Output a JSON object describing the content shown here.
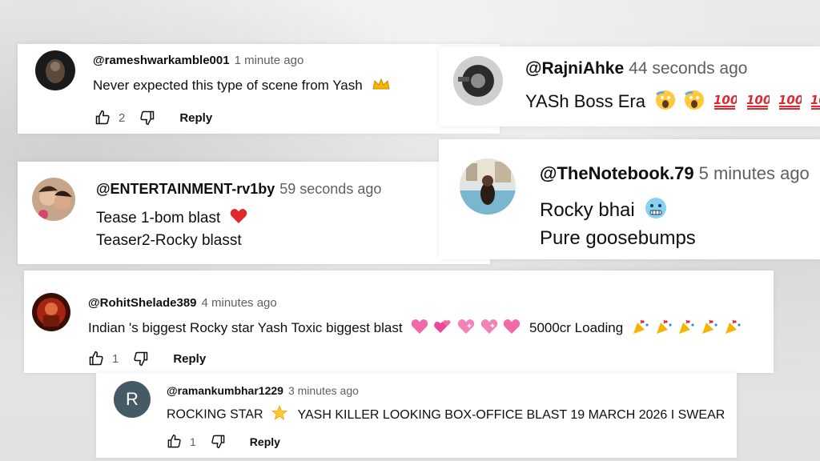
{
  "comments": [
    {
      "handle": "@rameshwarkamble001",
      "time": "1 minute ago",
      "lines": [
        "Never expected this type of scene from Yash"
      ],
      "emoji": "crown-emoji",
      "likes": "2",
      "reply_label": "Reply"
    },
    {
      "handle": "@RajniAhke",
      "time": "44 seconds ago",
      "lines": [
        "YASh Boss Era"
      ],
      "emoji": "screaming-face-and-hundred-points-emojis"
    },
    {
      "handle": "@ENTERTAINMENT-rv1by",
      "time": "59 seconds ago",
      "lines": [
        "Tease 1-bom blast",
        "Teaser2-Rocky blasst"
      ],
      "emoji": "red-heart-emoji"
    },
    {
      "handle": "@TheNotebook.79",
      "time": "5 minutes ago",
      "lines": [
        "Rocky bhai",
        "Pure goosebumps"
      ],
      "emoji": "cold-face-emoji"
    },
    {
      "handle": "@RohitShelade389",
      "time": "4 minutes ago",
      "text_before": "Indian 's biggest Rocky star Yash Toxic biggest blast",
      "text_after": "5000cr Loading",
      "emoji": "hearts-and-party-popper-emojis",
      "likes": "1",
      "reply_label": "Reply"
    },
    {
      "handle": "@ramankumbhar1229",
      "time": "3 minutes ago",
      "avatar_letter": "R",
      "text_before": "ROCKING STAR",
      "text_after": "YASH KILLER LOOKING BOX-OFFICE BLAST 19 MARCH 2026 I SWEAR",
      "emoji": "glowing-star-emoji",
      "likes": "1",
      "reply_label": "Reply"
    }
  ],
  "colors": {
    "text": "#0f0f0f",
    "meta": "#606060",
    "heart": "#e0282e",
    "pink": "#f06aa8",
    "reply_avatar": "#455a64"
  }
}
